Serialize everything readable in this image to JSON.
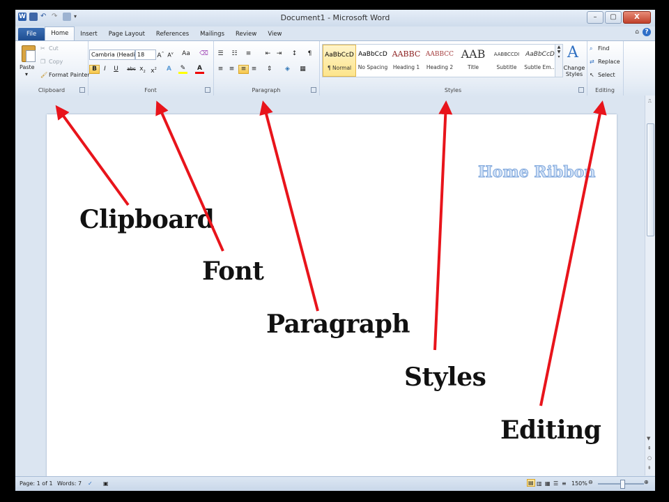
{
  "window": {
    "title": "Document1 - Microsoft Word",
    "controls": {
      "minimize": "–",
      "maximize": "▢",
      "close": "X"
    }
  },
  "tabs": [
    "File",
    "Home",
    "Insert",
    "Page Layout",
    "References",
    "Mailings",
    "Review",
    "View"
  ],
  "active_tab": "Home",
  "ribbon": {
    "clipboard": {
      "label": "Clipboard",
      "paste": "Paste",
      "cut": "Cut",
      "copy": "Copy",
      "format_painter": "Format Painter"
    },
    "font": {
      "label": "Font",
      "font_name": "Cambria (Headi",
      "font_size": "18",
      "case_button": "Aa"
    },
    "paragraph": {
      "label": "Paragraph",
      "pilcrow": "¶"
    },
    "styles": {
      "label": "Styles",
      "items": [
        {
          "preview": "AaBbCcD",
          "name": "¶ Normal"
        },
        {
          "preview": "AaBbCcD",
          "name": "No Spacing"
        },
        {
          "preview": "AABBC",
          "name": "Heading 1"
        },
        {
          "preview": "AABBCC",
          "name": "Heading 2"
        },
        {
          "preview": "AAB",
          "name": "Title"
        },
        {
          "preview": "AABBCCDI",
          "name": "Subtitle"
        },
        {
          "preview": "AaBbCcD",
          "name": "Subtle Em..."
        }
      ],
      "change_styles": "Change Styles"
    },
    "editing": {
      "label": "Editing",
      "find": "Find",
      "replace": "Replace",
      "select": "Select"
    }
  },
  "status": {
    "page": "Page: 1 of 1",
    "words": "Words: 7",
    "zoom": "150%"
  },
  "document": {
    "heading": "Home Ribbon"
  },
  "callouts": {
    "clipboard": "Clipboard",
    "font": "Font",
    "paragraph": "Paragraph",
    "styles": "Styles",
    "editing": "Editing"
  },
  "colors": {
    "arrow": "#e8141b",
    "file_tab": "#2b579a",
    "selected_style": "#fde58c"
  }
}
